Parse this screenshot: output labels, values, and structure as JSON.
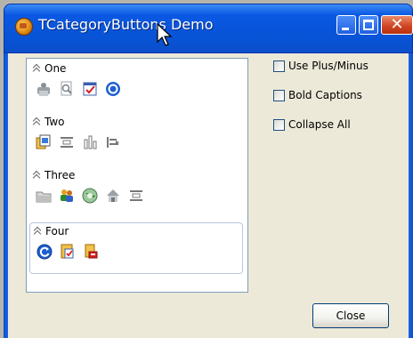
{
  "window": {
    "title": "TCategoryButtons Demo",
    "icon": "app-icon",
    "caption_buttons": [
      "minimize",
      "maximize",
      "close"
    ]
  },
  "categories": [
    {
      "caption": "One",
      "buttons": [
        "printer-icon",
        "find-icon",
        "checklist-icon",
        "target-icon"
      ]
    },
    {
      "caption": "Two",
      "buttons": [
        "image-stack-icon",
        "align-icon",
        "columns-icon",
        "indent-icon"
      ]
    },
    {
      "caption": "Three",
      "buttons": [
        "folder-icon",
        "people-icon",
        "globe-icon",
        "home-icon",
        "align-icon"
      ]
    },
    {
      "caption": "Four",
      "buttons": [
        "refresh-icon",
        "edit-doc-icon",
        "lock-doc-icon"
      ]
    }
  ],
  "options": [
    {
      "label": "Use Plus/Minus",
      "checked": false
    },
    {
      "label": "Bold Captions",
      "checked": false
    },
    {
      "label": "Collapse All",
      "checked": false
    }
  ],
  "close_label": "Close"
}
